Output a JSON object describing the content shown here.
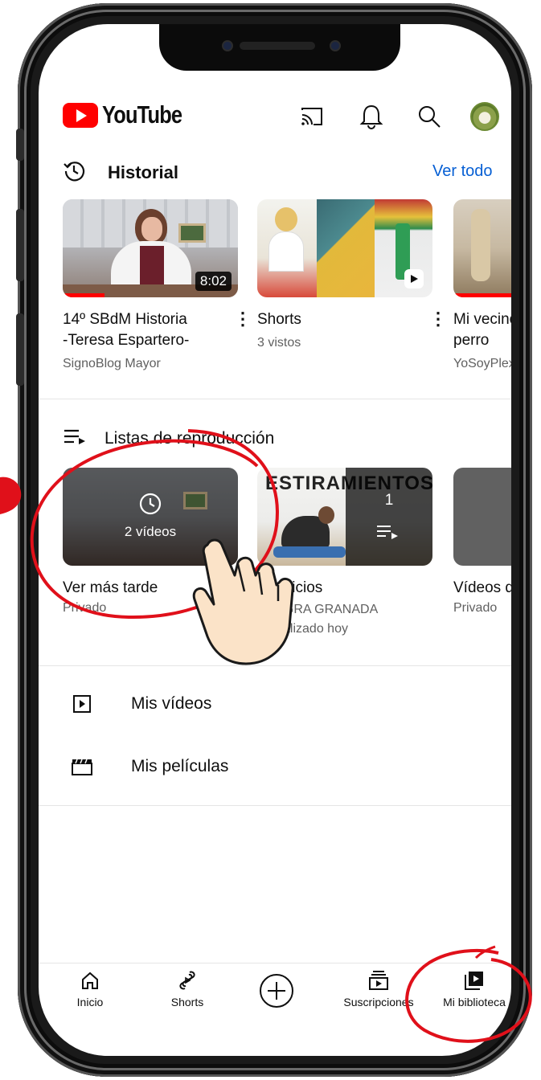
{
  "app": {
    "name": "YouTube"
  },
  "header": {
    "icons": [
      "cast-icon",
      "bell-icon",
      "search-icon",
      "avatar"
    ]
  },
  "history": {
    "title": "Historial",
    "see_all": "Ver todo",
    "items": [
      {
        "title_line1": "14º SBdM Historia",
        "title_line2": "-Teresa Espartero-",
        "channel": "SignoBlog Mayor",
        "duration": "8:02"
      },
      {
        "title_line1": "Shorts",
        "title_line2": "",
        "channel": "3 vistos",
        "duration": ""
      },
      {
        "title_line1": "Mi vecino",
        "title_line2": "perro",
        "channel": "YoSoyPlex",
        "duration": ""
      }
    ]
  },
  "playlists": {
    "title": "Listas de reproducción",
    "items": [
      {
        "title": "Ver más tarde",
        "sub": "Privado",
        "overlay": "2 vídeos"
      },
      {
        "title": "Ejercicios",
        "sub1": "SUEGRA GRANADA",
        "sub2": "Actualizado hoy",
        "thumb_text": "ESTIRAMIENTOS",
        "count": "1"
      },
      {
        "title": "Vídeos que",
        "sub": "Privado"
      }
    ]
  },
  "library": {
    "items": [
      {
        "label": "Mis vídeos",
        "icon": "play-square-icon"
      },
      {
        "label": "Mis películas",
        "icon": "clapperboard-icon"
      }
    ]
  },
  "bottom_nav": [
    {
      "label": "Inicio",
      "icon": "home-icon"
    },
    {
      "label": "Shorts",
      "icon": "shorts-icon"
    },
    {
      "label": "",
      "icon": "create-plus-icon"
    },
    {
      "label": "Suscripciones",
      "icon": "subscriptions-icon"
    },
    {
      "label": "Mi biblioteca",
      "icon": "library-icon"
    }
  ],
  "colors": {
    "accent_red": "#ff0000",
    "link_blue": "#065fd4",
    "annotation_red": "#e0101a",
    "text_secondary": "#606060"
  }
}
